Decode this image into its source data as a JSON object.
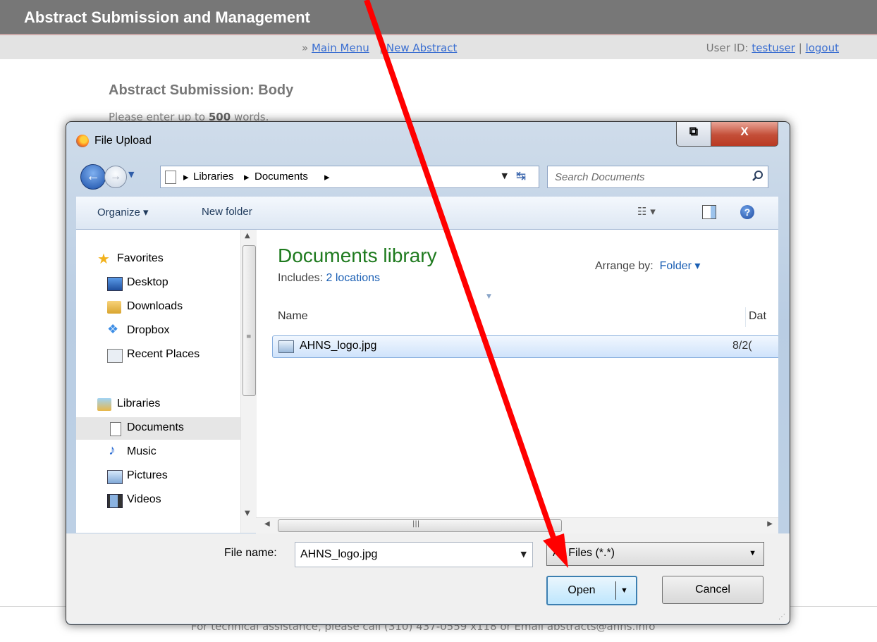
{
  "page": {
    "title": "Abstract Submission and Management",
    "nav": {
      "prefix": "»",
      "main_menu": "Main Menu",
      "sep1": "|",
      "new_abstract": "New Abstract"
    },
    "user": {
      "label": "User ID:",
      "username": "testuser",
      "sep": "|",
      "logout": "logout"
    },
    "heading": "Abstract Submission: Body",
    "instruction_prefix": "Please enter up to ",
    "instruction_count": "500",
    "instruction_suffix": " words.",
    "footer": "For technical assistance, please call (310) 437-0559 x118 or Email abstracts@ahns.info"
  },
  "dialog": {
    "title": "File Upload",
    "close_glyph": "X",
    "breadcrumb": [
      "Libraries",
      "Documents"
    ],
    "search_placeholder": "Search Documents",
    "toolbar": {
      "organize": "Organize ▾",
      "new_folder": "New folder"
    },
    "nav_pane": {
      "favorites": "Favorites",
      "favorites_items": [
        "Desktop",
        "Downloads",
        "Dropbox",
        "Recent Places"
      ],
      "libraries": "Libraries",
      "libraries_items": [
        "Documents",
        "Music",
        "Pictures",
        "Videos"
      ],
      "selected": "Documents"
    },
    "library": {
      "title": "Documents library",
      "includes_label": "Includes:",
      "includes_link": "2 locations",
      "arrange_label": "Arrange by:",
      "arrange_value": "Folder ▾"
    },
    "columns": {
      "name": "Name",
      "date": "Dat"
    },
    "files": [
      {
        "name": "AHNS_logo.jpg",
        "date": "8/2("
      }
    ],
    "file_name_label": "File name:",
    "file_name_value": "AHNS_logo.jpg",
    "file_type": "All Files (*.*)",
    "open_label": "Open",
    "cancel_label": "Cancel"
  },
  "annotation": {
    "arrow_color": "#ff0000"
  },
  "colors": {
    "header_bg": "#777777",
    "library_title": "#1e7a1e",
    "link": "#3b6fd1"
  }
}
